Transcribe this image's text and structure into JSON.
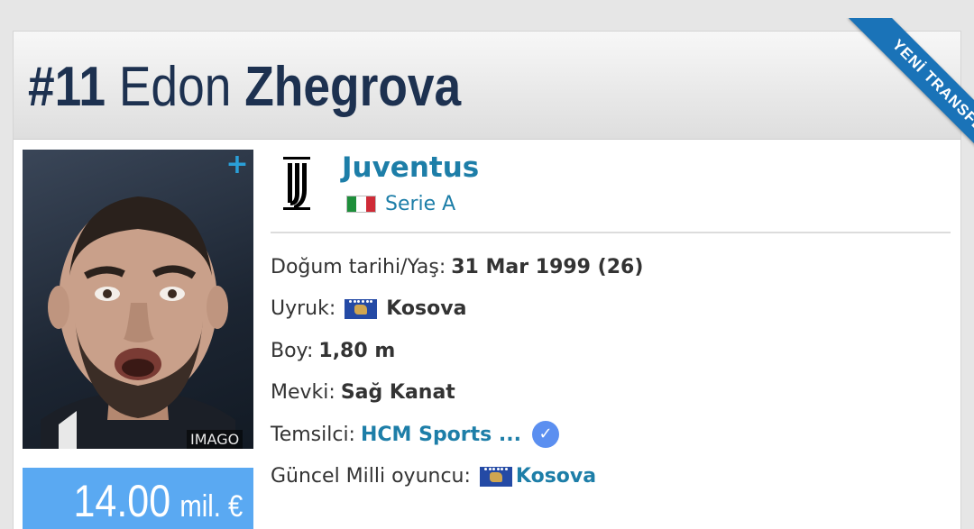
{
  "header": {
    "number": "#11",
    "first_name": "Edon",
    "last_name": "Zhegrova",
    "ribbon": "YENİ TRANSFER"
  },
  "photo": {
    "credit": "IMAGO",
    "expand_icon": "plus-icon"
  },
  "market_value": {
    "amount": "14.00",
    "unit": "mil. €"
  },
  "club": {
    "name": "Juventus",
    "league": "Serie A",
    "league_flag": "italy-flag-icon",
    "logo": "juventus-logo"
  },
  "info": {
    "birth_label": "Doğum tarihi/Yaş:",
    "birth_value": "31 Mar 1999 (26)",
    "nationality_label": "Uyruk:",
    "nationality_value": "Kosova",
    "height_label": "Boy:",
    "height_value": "1,80 m",
    "position_label": "Mevki:",
    "position_value": "Sağ Kanat",
    "agent_label": "Temsilci:",
    "agent_value": "HCM Sports ...",
    "national_label": "Güncel Milli oyuncu:",
    "national_value": "Kosova"
  },
  "colors": {
    "title": "#1d3150",
    "link": "#1d7ea8",
    "ribbon": "#1a73b8",
    "value_box": "#5aa9f2",
    "verified": "#5b8ff0"
  }
}
